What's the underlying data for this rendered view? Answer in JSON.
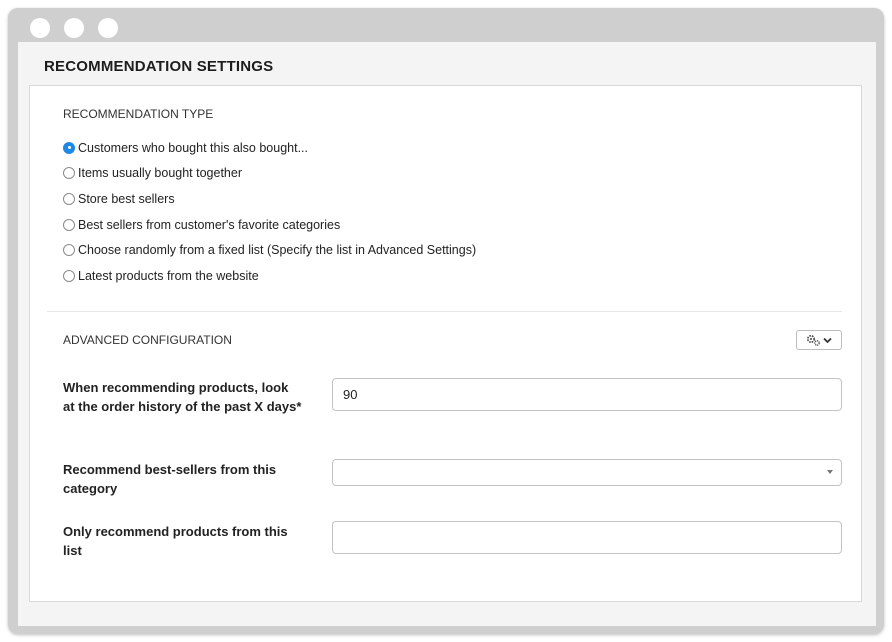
{
  "page": {
    "title": "RECOMMENDATION SETTINGS"
  },
  "recommendation_type": {
    "heading": "RECOMMENDATION TYPE",
    "selected_index": 0,
    "options": [
      {
        "label": "Customers who bought this also bought...",
        "selected": true
      },
      {
        "label": "Items usually bought together",
        "selected": false
      },
      {
        "label": "Store best sellers",
        "selected": false
      },
      {
        "label": "Best sellers from customer's favorite categories",
        "selected": false
      },
      {
        "label": "Choose randomly from a fixed list (Specify the list in Advanced Settings)",
        "selected": false
      },
      {
        "label": "Latest products from the website",
        "selected": false
      }
    ]
  },
  "advanced": {
    "heading": "ADVANCED CONFIGURATION",
    "settings_button_icon": "gears-icon",
    "settings_button_caret": "chevron-down-icon",
    "fields": {
      "order_history": {
        "label": "When recommending products, look at the order history of the past X days*",
        "value": "90"
      },
      "category": {
        "label": "Recommend best-sellers from this category",
        "value": ""
      },
      "product_list": {
        "label": "Only recommend products from this list",
        "value": ""
      }
    }
  },
  "colors": {
    "accent": "#1e88e5",
    "window_frame": "#cfcfcf",
    "panel_background": "#f4f4f4",
    "card_background": "#ffffff"
  }
}
